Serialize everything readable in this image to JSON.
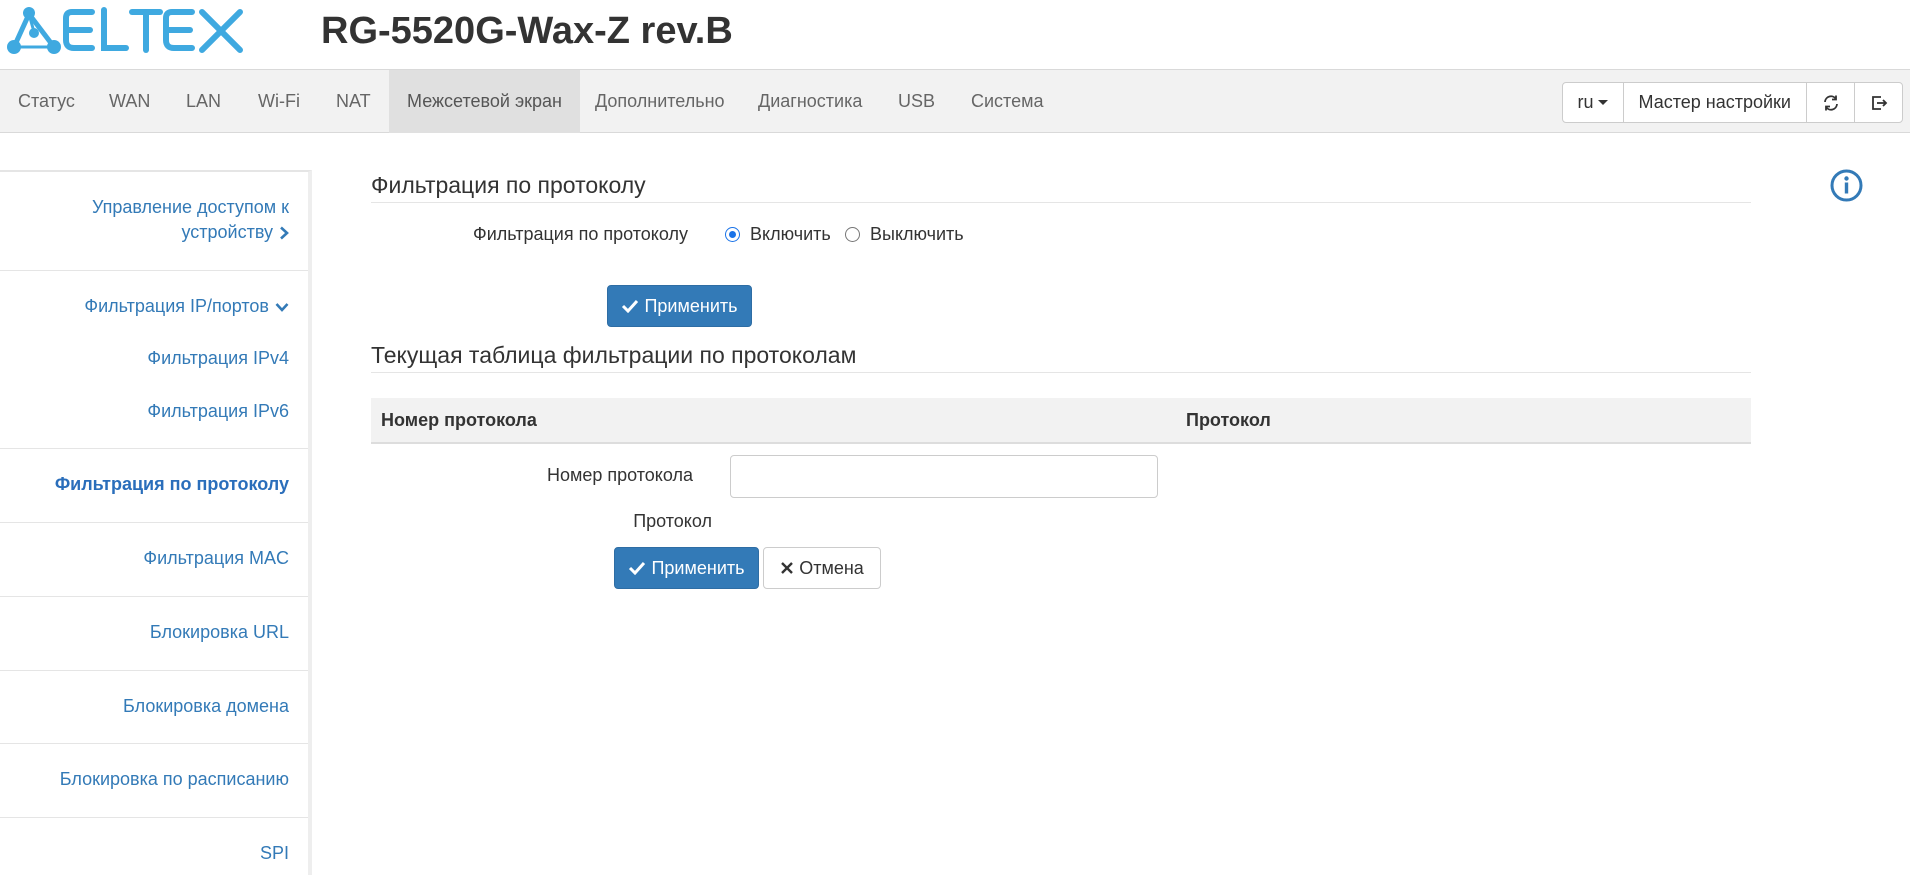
{
  "brand": {
    "logo_text": "ELTEX",
    "device_title": "RG-5520G-Wax-Z rev.B",
    "accent_color": "#3fa9e0"
  },
  "nav": {
    "items": [
      {
        "label": "Статус"
      },
      {
        "label": "WAN"
      },
      {
        "label": "LAN"
      },
      {
        "label": "Wi-Fi"
      },
      {
        "label": "NAT"
      },
      {
        "label": "Межсетевой экран",
        "active": true
      },
      {
        "label": "Дополнительно"
      },
      {
        "label": "Диагностика"
      },
      {
        "label": "USB"
      },
      {
        "label": "Система"
      }
    ],
    "language": "ru",
    "wizard_label": "Мастер настройки",
    "refresh_icon": "refresh-icon",
    "logout_icon": "logout-icon"
  },
  "sidebar": {
    "items": [
      {
        "label_line1": "Управление доступом к",
        "label_line2": "устройству",
        "icon": "chevron-right-icon"
      },
      {
        "label": "Фильтрация IP/портов",
        "icon": "chevron-down-icon"
      },
      {
        "label": "Фильтрация IPv4"
      },
      {
        "label": "Фильтрация IPv6"
      },
      {
        "label": "Фильтрация по протоколу",
        "active": true
      },
      {
        "label": "Фильтрация MAC"
      },
      {
        "label": "Блокировка URL"
      },
      {
        "label": "Блокировка домена"
      },
      {
        "label": "Блокировка по расписанию"
      },
      {
        "label": "SPI"
      }
    ]
  },
  "main": {
    "section1_title": "Фильтрация по протоколу",
    "filter_label": "Фильтрация по протоколу",
    "radio_enable": "Включить",
    "radio_disable": "Выключить",
    "radio_selected": "Включить",
    "apply_label": "Применить",
    "section2_title": "Текущая таблица фильтрации по протоколам",
    "table": {
      "columns": [
        "Номер протокола",
        "Протокол"
      ],
      "rows": []
    },
    "form": {
      "protocol_number_label": "Номер протокола",
      "protocol_number_value": "",
      "protocol_label": "Протокол",
      "apply_label": "Применить",
      "cancel_label": "Отмена"
    },
    "info_icon": "info-icon"
  }
}
